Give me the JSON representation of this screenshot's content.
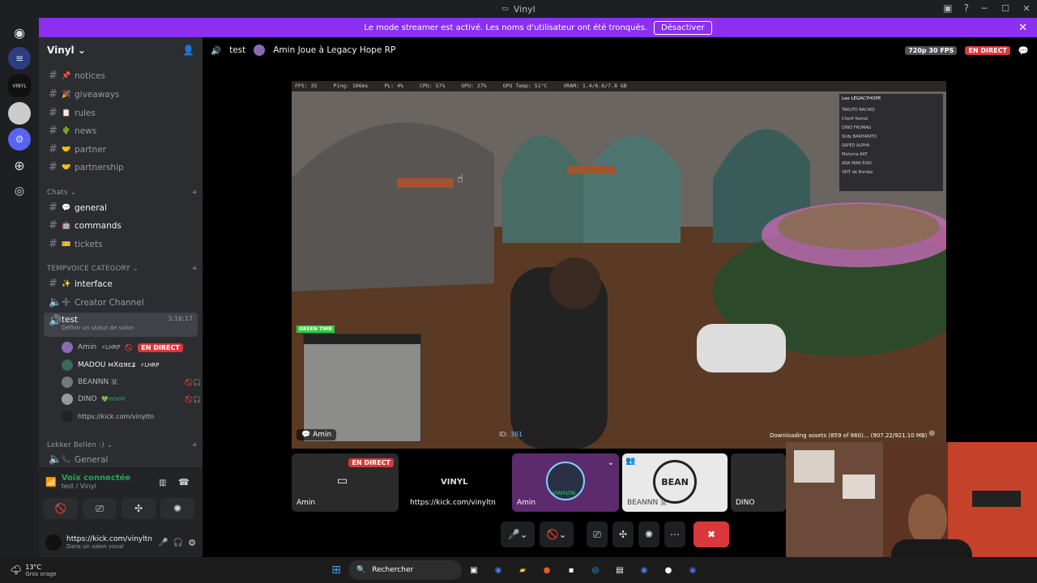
{
  "window": {
    "title": "Vinyl"
  },
  "banner": {
    "text": "Le mode streamer est activé. Les noms d'utilisateur ont été tronqués.",
    "button": "Désactiver"
  },
  "server": {
    "name": "Vinyl"
  },
  "channels": {
    "info": [
      {
        "label": "notices",
        "emoji": "📌"
      },
      {
        "label": "giveaways",
        "emoji": "🎉"
      },
      {
        "label": "rules",
        "emoji": "📋"
      },
      {
        "label": "news",
        "emoji": "🌵"
      },
      {
        "label": "partner",
        "emoji": "🤝"
      },
      {
        "label": "partnership",
        "emoji": "🤝"
      }
    ],
    "chats_label": "Chats",
    "chats": [
      {
        "label": "general",
        "emoji": "💬"
      },
      {
        "label": "commands",
        "emoji": "🤖"
      },
      {
        "label": "tickets",
        "emoji": "🎫"
      }
    ],
    "tempvoice_label": "TEMPVOICE CATEGORY",
    "interface": "interface",
    "creator": "Creator Channel",
    "voice_channel": "test",
    "voice_time": "3:16:17",
    "voice_status": "Définir un statut de salon",
    "members": [
      {
        "name": "Amin",
        "tag": "⚡LHRP",
        "live": "EN DIRECT"
      },
      {
        "name": "MADOU мХαяεʑ",
        "tag": "⚡LHRP"
      },
      {
        "name": "BEANNN 🇲"
      },
      {
        "name": "DINO",
        "tag": "💚WWM"
      },
      {
        "name": "https://kick.com/vinyltn"
      }
    ],
    "lekker_label": "Lekker Bellen :)",
    "general_voice": "General"
  },
  "voice": {
    "status": "Voix connectée",
    "location": "test / Vinyl"
  },
  "user": {
    "name": "https://kick.com/vinyltn",
    "status": "Dans un salon vocal"
  },
  "header": {
    "channel": "test",
    "activity": "Amin Joue à Legacy Hope RP",
    "quality": "720p 30 FPS",
    "live": "EN DIRECT"
  },
  "stream": {
    "hud": [
      "FPS: 35",
      "Ping: 106ms",
      "PL: 4%",
      "CPU: 57%",
      "GPU: 27%",
      "GPU Temp: 51°C",
      "VRAM: 1.4/6.6/7.8 GB"
    ],
    "streamer": "Amin",
    "id_label": "ID:",
    "id_value": "361",
    "green": "GREEN TIME",
    "download": "Downloading assets (859 of 860)... (907.22/921.10 MB)",
    "scoreboard_title": "Lee LEGACYHOPE",
    "scoreboard": [
      "TAKUTO RACHIQ",
      "Cherif Kamal",
      "DINO FROMAG",
      "Slidy BAKHANITO",
      "SAYED ALPHA",
      "Mohsine KAT",
      "ADA MAN EIXO",
      "VEIT de Bomba"
    ]
  },
  "tiles": [
    {
      "name": "Amin",
      "live": "EN DIRECT"
    },
    {
      "name": "https://kick.com/vinyltn",
      "logo": "VINYL"
    },
    {
      "name": "Amin",
      "overlay": "VINYLTN"
    },
    {
      "name": "BEANNN 🇲",
      "logo": "BEAN"
    },
    {
      "name": "DINO"
    }
  ],
  "taskbar": {
    "temp": "13°C",
    "weather": "Gros orage",
    "search": "Rechercher"
  }
}
